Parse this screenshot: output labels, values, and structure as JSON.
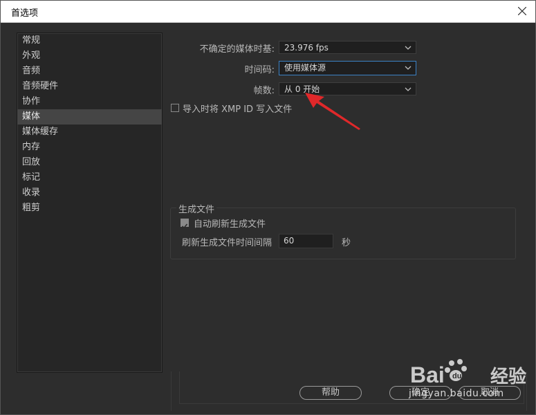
{
  "window": {
    "title": "首选项"
  },
  "sidebar": {
    "items": [
      {
        "label": "常规"
      },
      {
        "label": "外观"
      },
      {
        "label": "音频"
      },
      {
        "label": "音频硬件"
      },
      {
        "label": "协作"
      },
      {
        "label": "媒体",
        "active": true
      },
      {
        "label": "媒体缓存"
      },
      {
        "label": "内存"
      },
      {
        "label": "回放"
      },
      {
        "label": "标记"
      },
      {
        "label": "收录"
      },
      {
        "label": "粗剪"
      }
    ]
  },
  "media": {
    "timebase_label": "不确定的媒体时基:",
    "timebase_value": "23.976 fps",
    "timecode_label": "时间码:",
    "timecode_value": "使用媒体源",
    "frames_label": "帧数:",
    "frames_value": "从 0 开始",
    "xmp_checkbox_label": "导入时将 XMP ID 写入文件",
    "xmp_checked": false
  },
  "generated_files": {
    "group_title": "生成文件",
    "auto_refresh_label": "自动刷新生成文件",
    "auto_refresh_checked": true,
    "interval_label": "刷新生成文件时间间隔",
    "interval_value": "60",
    "interval_unit": "秒"
  },
  "buttons": {
    "help": "帮助",
    "ok": "确定",
    "cancel": "取消"
  },
  "watermark": {
    "brand_cn": "经验",
    "url": "jingyan.baidu.com"
  },
  "colors": {
    "dialog_bg": "#2d2d2d",
    "focus_border": "#3b82c6",
    "annotation_arrow": "#e0282a"
  }
}
